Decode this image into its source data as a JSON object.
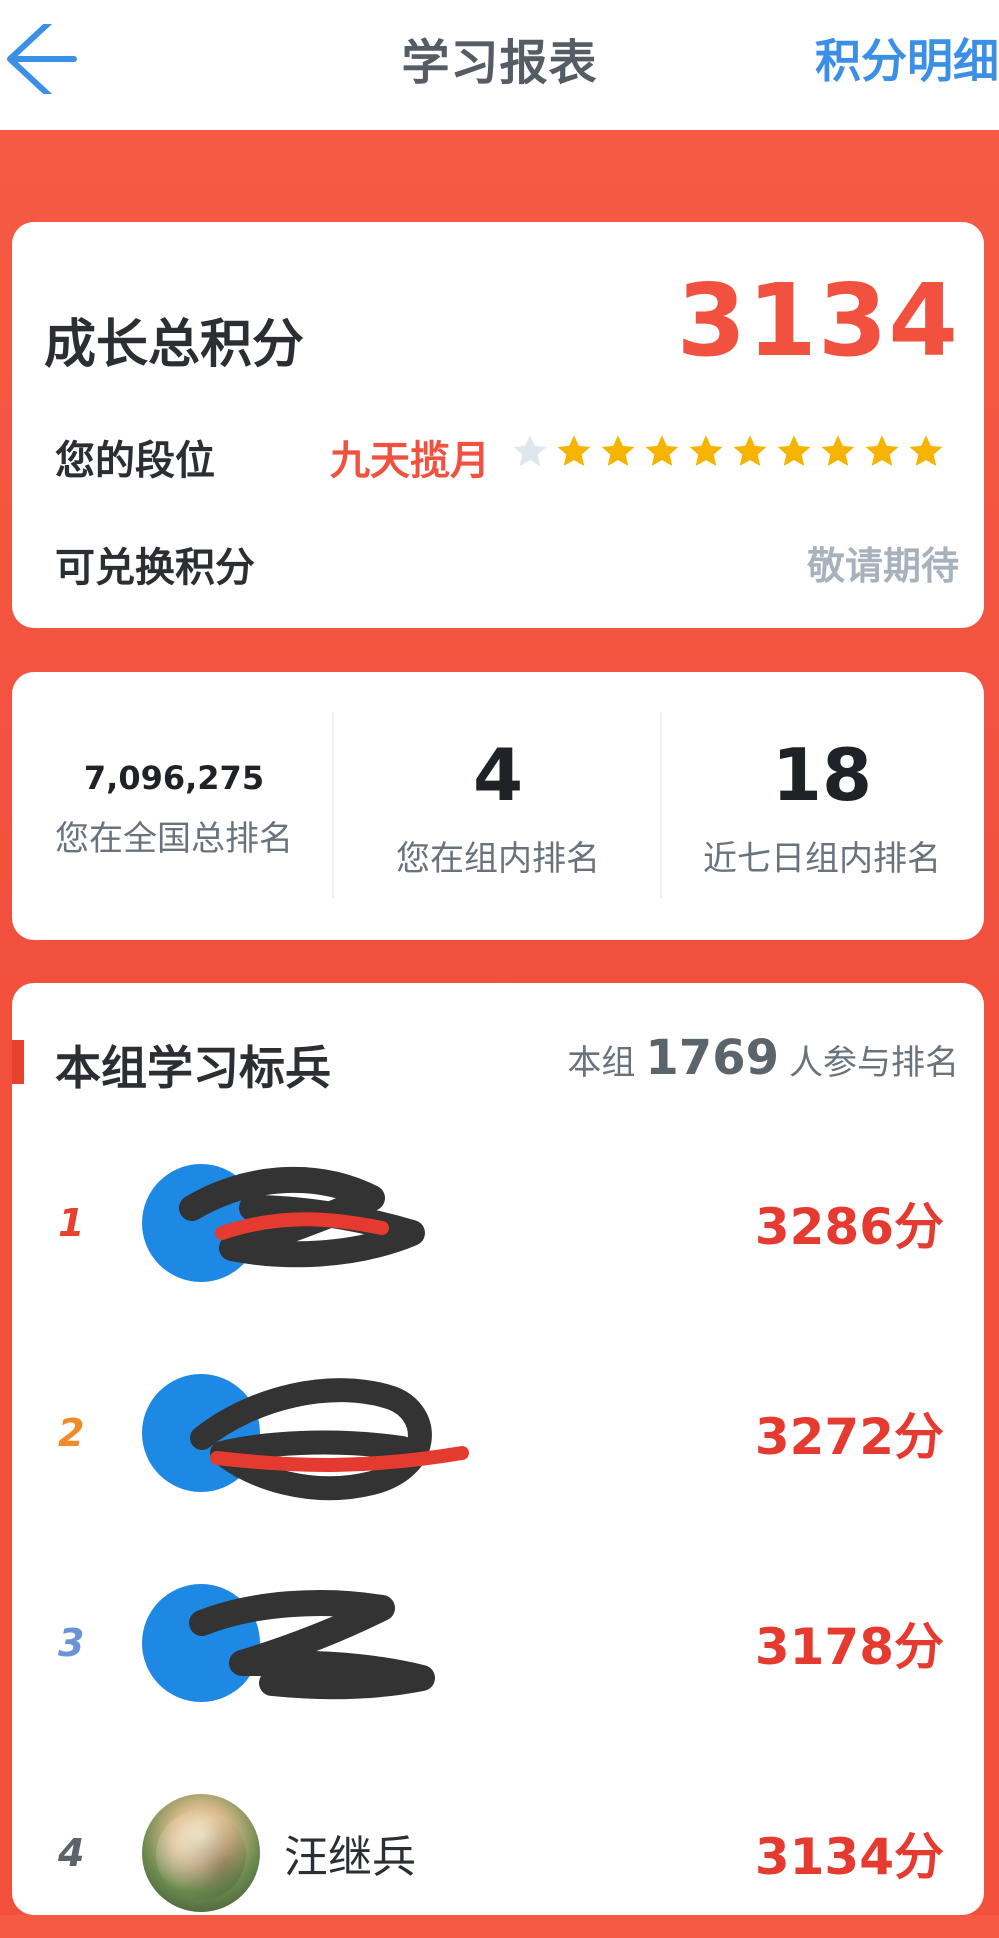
{
  "header": {
    "title": "学习报表",
    "right_link": "积分明细"
  },
  "summary": {
    "total_label": "成长总积分",
    "total_value": "3134",
    "rank_label": "您的段位",
    "rank_name": "九天揽月",
    "stars_total": 10,
    "stars_filled": 9,
    "exchange_label": "可兑换积分",
    "exchange_value": "敬请期待"
  },
  "ranks": {
    "national": {
      "value": "7,096,275",
      "caption": "您在全国总排名"
    },
    "group": {
      "value": "4",
      "caption": "您在组内排名"
    },
    "group_7days": {
      "value": "18",
      "caption": "近七日组内排名"
    }
  },
  "leaders": {
    "title": "本组学习标兵",
    "participants_prefix": "本组",
    "participants_count": "1769",
    "participants_suffix": "人参与排名",
    "rows": [
      {
        "rank": "1",
        "name": "",
        "score": "3286分"
      },
      {
        "rank": "2",
        "name": "",
        "score": "3272分"
      },
      {
        "rank": "3",
        "name": "",
        "score": "3178分"
      },
      {
        "rank": "4",
        "name": "汪继兵",
        "score": "3134分"
      }
    ]
  },
  "colors": {
    "accent_red": "#f25140",
    "score_red": "#e53a2f",
    "blue_link": "#3b90e6",
    "background": "#f45a44",
    "star_gold": "#f6b400",
    "star_gray": "#dfe6ee"
  }
}
